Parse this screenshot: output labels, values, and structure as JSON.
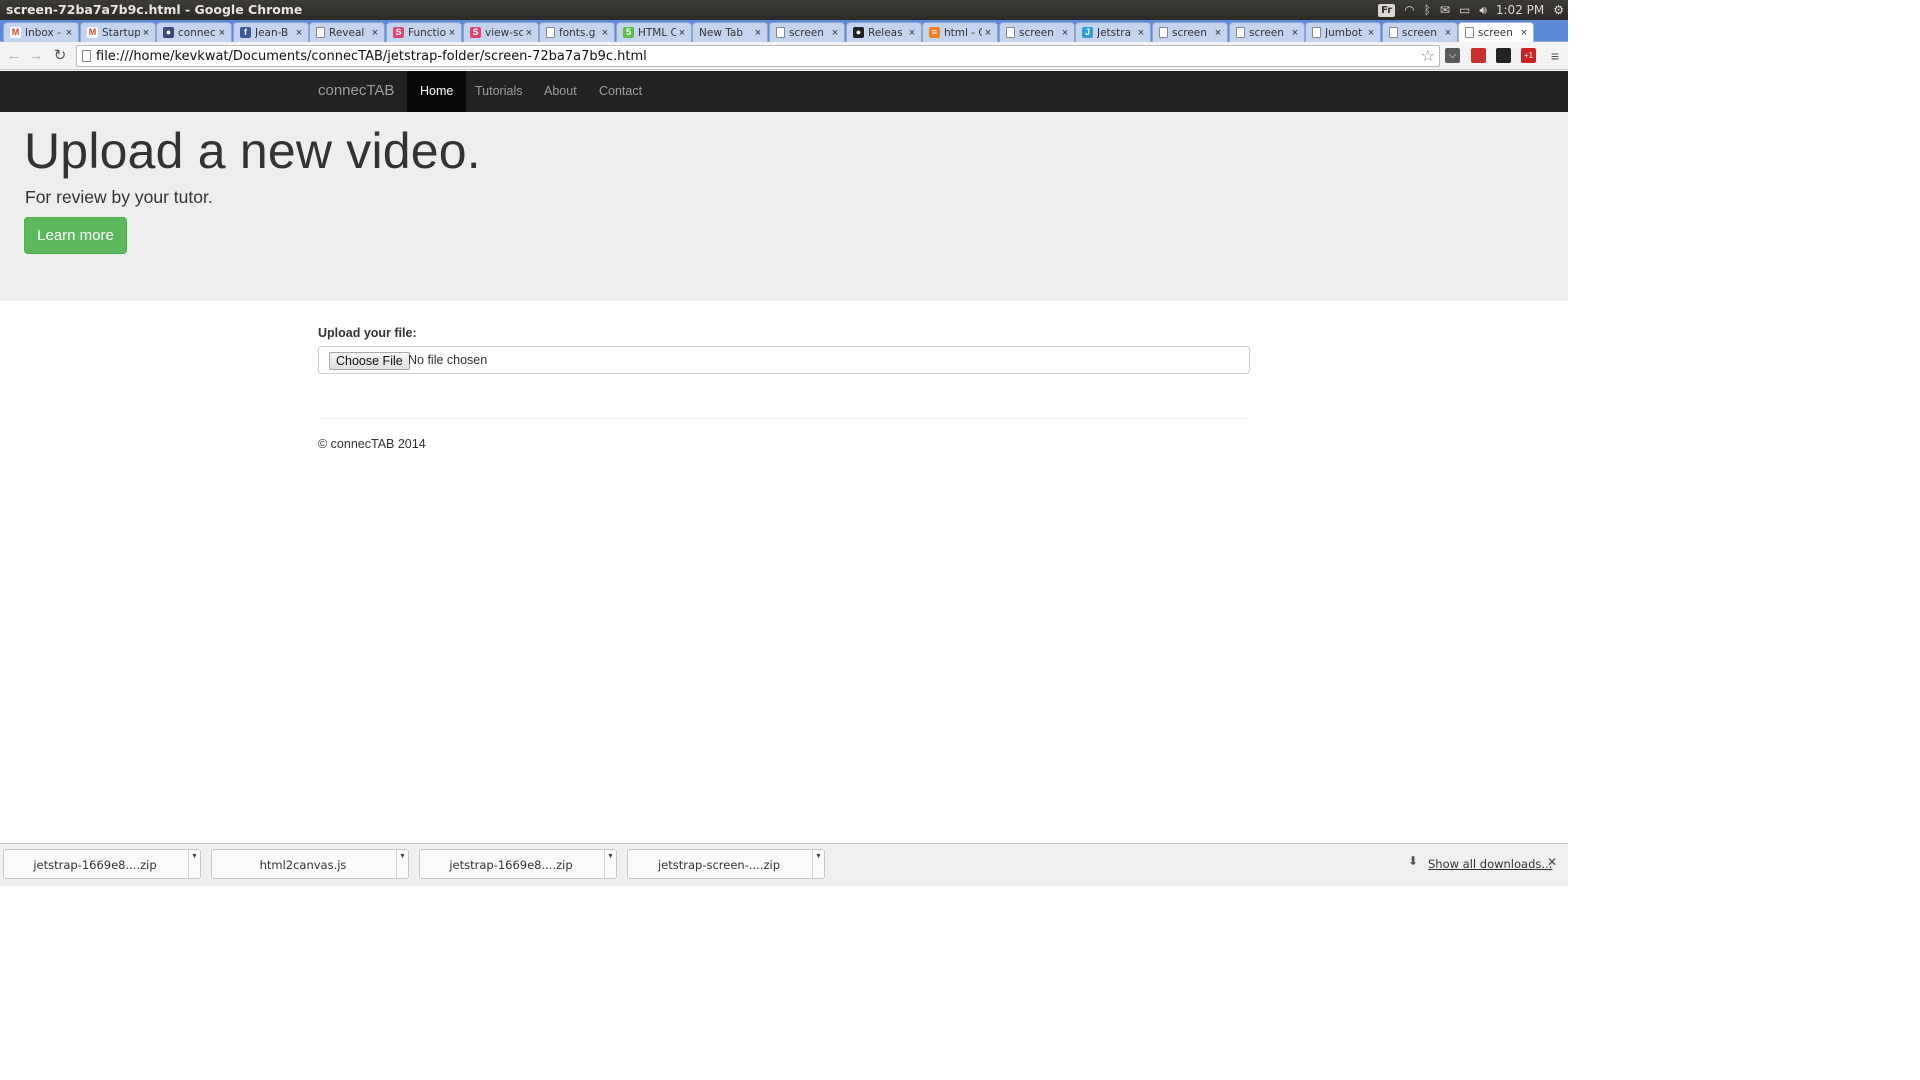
{
  "os": {
    "window_title": "screen-72ba7a7b9c.html - Google Chrome",
    "keyboard": "Fr",
    "clock": "1:02 PM"
  },
  "tabs": [
    {
      "label": "Inbox -",
      "icon": "gmail-icon",
      "color": "#d44638"
    },
    {
      "label": "Startup",
      "icon": "gmail-icon",
      "color": "#d44638"
    },
    {
      "label": "connec",
      "icon": "globe-icon",
      "color": "#3b4a7a"
    },
    {
      "label": "Jean-B",
      "icon": "facebook-icon",
      "color": "#3b5998"
    },
    {
      "label": "Reveal",
      "icon": "page-icon",
      "color": ""
    },
    {
      "label": "Functio",
      "icon": "s-icon",
      "color": "#e0436f"
    },
    {
      "label": "view-sc",
      "icon": "s-icon",
      "color": "#e0436f"
    },
    {
      "label": "fonts.g",
      "icon": "page-icon",
      "color": ""
    },
    {
      "label": "HTML C",
      "icon": "html5-icon",
      "color": "#5fbb46"
    },
    {
      "label": "New Tab",
      "icon": "",
      "color": ""
    },
    {
      "label": "screen",
      "icon": "page-icon",
      "color": ""
    },
    {
      "label": "Releas",
      "icon": "github-icon",
      "color": "#222222"
    },
    {
      "label": "html - C",
      "icon": "stack-icon",
      "color": "#f48024"
    },
    {
      "label": "screen",
      "icon": "page-icon",
      "color": ""
    },
    {
      "label": "Jetstra",
      "icon": "jetstrap-icon",
      "color": "#2e9fd8"
    },
    {
      "label": "screen",
      "icon": "page-icon",
      "color": ""
    },
    {
      "label": "screen",
      "icon": "page-icon",
      "color": ""
    },
    {
      "label": "Jumbot",
      "icon": "page-icon",
      "color": ""
    },
    {
      "label": "screen",
      "icon": "page-icon",
      "color": ""
    },
    {
      "label": "screen",
      "icon": "page-icon",
      "color": ""
    }
  ],
  "toolbar": {
    "url": "file:///home/kevkwat/Documents/connecTAB/jetstrap-folder/screen-72ba7a7b9c.html"
  },
  "navbar": {
    "brand": "connecTAB",
    "links": [
      "Home",
      "Tutorials",
      "About",
      "Contact"
    ],
    "active": "Home"
  },
  "hero": {
    "title": "Upload a new video.",
    "subtitle": "For review by your tutor.",
    "button": "Learn more"
  },
  "upload": {
    "label": "Upload your file:",
    "button": "Choose File",
    "status": "No file chosen"
  },
  "footer": {
    "text": "© connecTAB 2014"
  },
  "downloads": {
    "items": [
      "jetstrap-1669e8....zip",
      "html2canvas.js",
      "jetstrap-1669e8....zip",
      "jetstrap-screen-....zip"
    ],
    "show_all": "Show all downloads..."
  },
  "colors": {
    "navbar_bg": "#222222",
    "jumbotron_bg": "#eeeeee",
    "success_button": "#5cb85c",
    "tab_strip": "#5b8ad9"
  }
}
